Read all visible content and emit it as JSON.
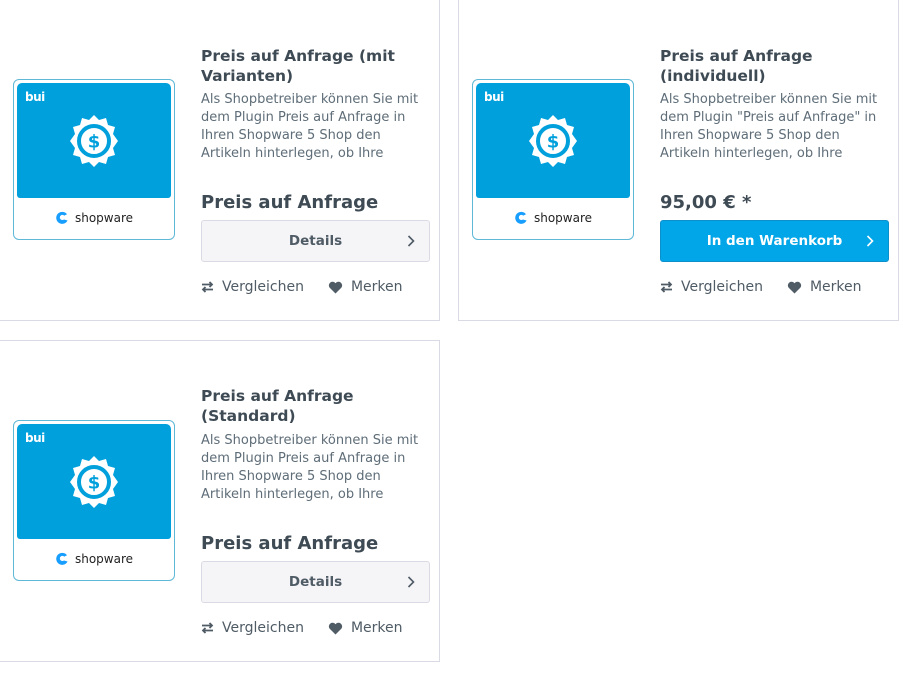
{
  "products": [
    {
      "title": "Preis auf Anfrage (mit Varianten)",
      "description": "Als Shopbetreiber können Sie mit dem Plugin Preis auf Anfrage in Ihren Shopware 5 Shop den Artikeln hinterlegen, ob Ihre",
      "price": "Preis auf Anfrage",
      "button_label": "Details",
      "compare_label": "Vergleichen",
      "wishlist_label": "Merken",
      "image_brand": "bui",
      "image_logo_text": "shopware"
    },
    {
      "title": "Preis auf Anfrage (individuell)",
      "description": "Als Shopbetreiber können Sie mit dem Plugin \"Preis auf Anfrage\" in Ihren Shopware 5 Shop den Artikeln hinterlegen, ob Ihre",
      "price": "95,00 € *",
      "button_label": "In den Warenkorb",
      "compare_label": "Vergleichen",
      "wishlist_label": "Merken",
      "image_brand": "bui",
      "image_logo_text": "shopware"
    },
    {
      "title": "Preis auf Anfrage (Standard)",
      "description": "Als Shopbetreiber können Sie mit dem Plugin Preis auf Anfrage in Ihren Shopware 5 Shop den Artikeln hinterlegen, ob Ihre",
      "price": "Preis auf Anfrage",
      "button_label": "Details",
      "compare_label": "Vergleichen",
      "wishlist_label": "Merken",
      "image_brand": "bui",
      "image_logo_text": "shopware"
    }
  ],
  "colors": {
    "accent": "#00a0dc",
    "buy_button": "#00a6e8",
    "border": "#dadae5",
    "text": "#3e4a54"
  },
  "icons": {
    "compare": "compare-arrows-icon",
    "wishlist": "heart-icon",
    "button_arrow": "chevron-right-icon",
    "badge": "dollar-badge-icon"
  }
}
